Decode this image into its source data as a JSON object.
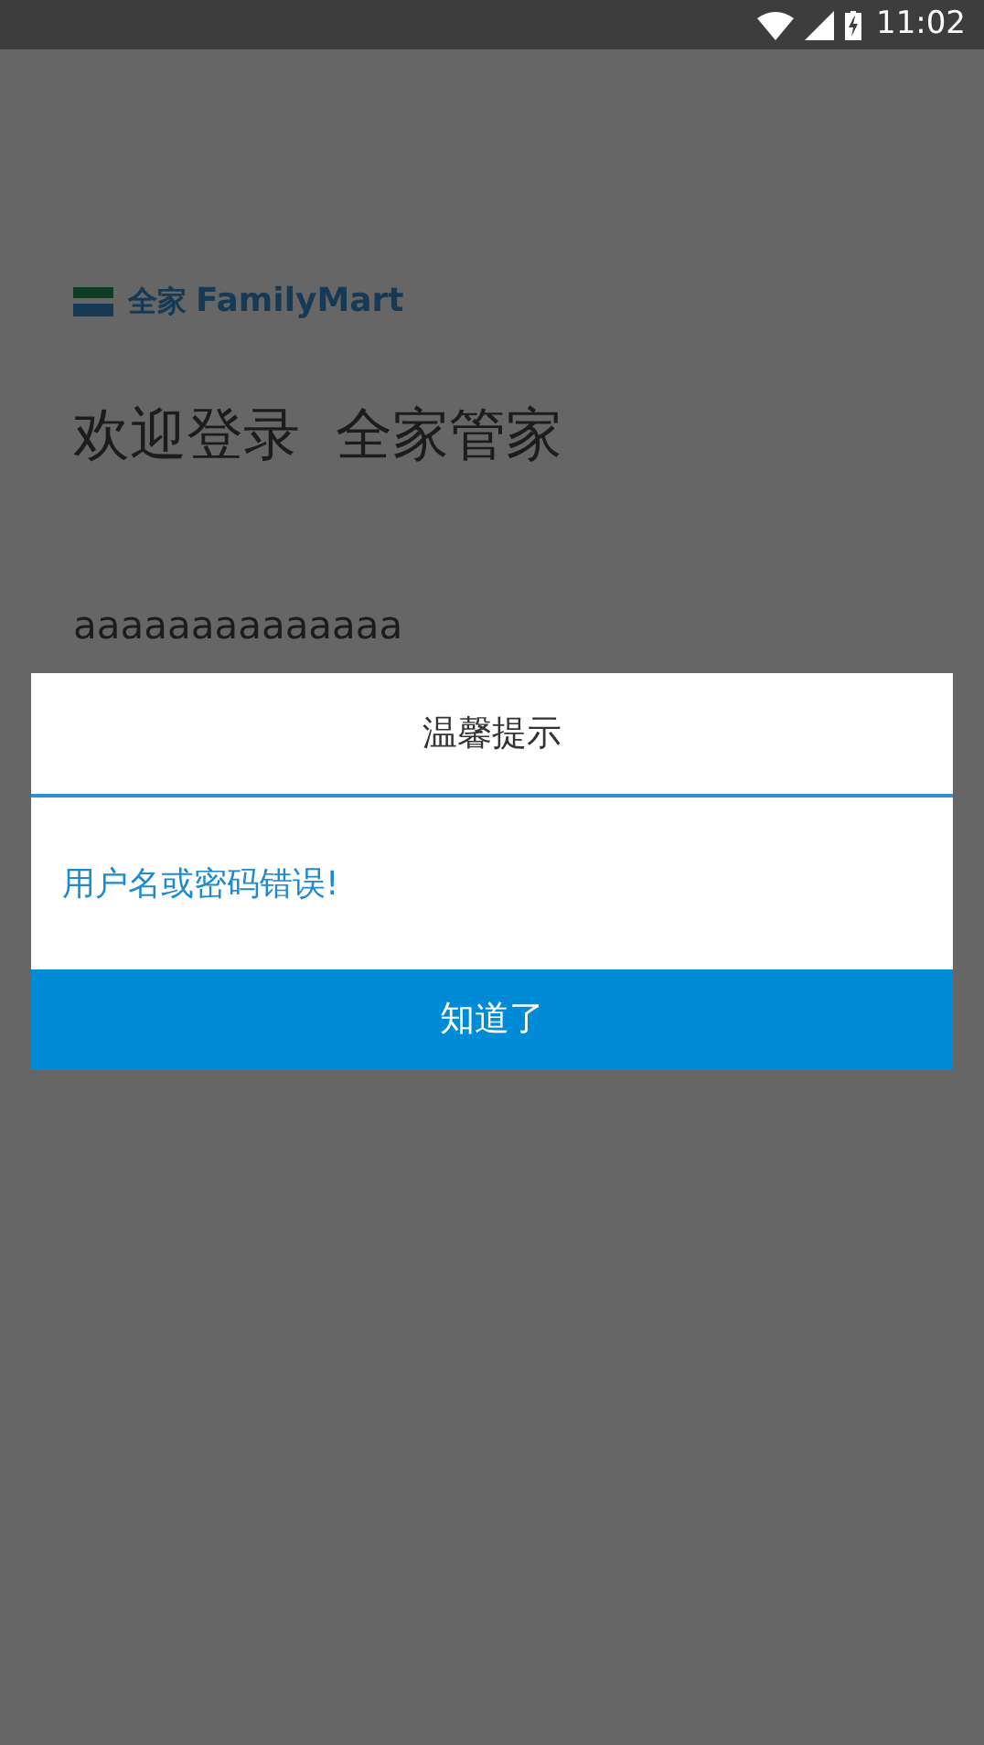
{
  "status_bar": {
    "time": "11:02"
  },
  "logo": {
    "cn": "全家",
    "en": "FamilyMart"
  },
  "heading": "欢迎登录  全家管家",
  "username_field": {
    "value": "aaaaaaaaaaaaaa"
  },
  "dialog": {
    "title": "温馨提示",
    "message": "用户名或密码错误!",
    "button": "知道了"
  }
}
